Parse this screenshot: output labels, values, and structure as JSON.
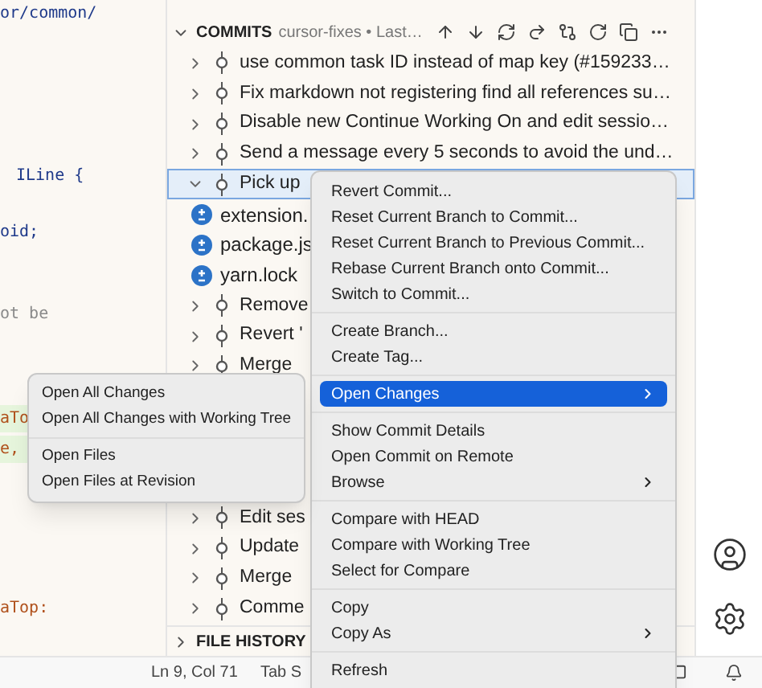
{
  "editor": {
    "lines": [
      {
        "text": "or/common/",
        "kind": "plain"
      },
      {
        "text": "ILine {",
        "kind": "plain"
      },
      {
        "text": "oid;",
        "kind": "plain"
      },
      {
        "text": "ot be",
        "kind": "comment"
      },
      {
        "text": "aTo",
        "kind": "added"
      },
      {
        "text": "e,",
        "kind": "added"
      },
      {
        "text": "aTop:",
        "kind": "string"
      }
    ]
  },
  "commits": {
    "title": "COMMITS",
    "branch": "cursor-fixes • Last…",
    "rows": [
      {
        "kind": "commit",
        "label": "use common task ID instead of map key (#159233…",
        "expanded": false,
        "selected": false
      },
      {
        "kind": "commit",
        "label": "Fix markdown not registering find all references su…",
        "expanded": false,
        "selected": false
      },
      {
        "kind": "commit",
        "label": "Disable new Continue Working On and edit sessio…",
        "expanded": false,
        "selected": false
      },
      {
        "kind": "commit",
        "label": "Send a message every 5 seconds to avoid the und…",
        "expanded": false,
        "selected": false
      },
      {
        "kind": "commit",
        "label": "Pick up",
        "expanded": true,
        "selected": true
      },
      {
        "kind": "file",
        "label": "extension."
      },
      {
        "kind": "file",
        "label": "package.js"
      },
      {
        "kind": "file",
        "label": "yarn.lock"
      },
      {
        "kind": "commit",
        "label": "Remove",
        "expanded": false,
        "selected": false
      },
      {
        "kind": "commit",
        "label": "Revert '",
        "expanded": false,
        "selected": false
      },
      {
        "kind": "commit",
        "label": "Merge",
        "expanded": false,
        "selected": false
      },
      {
        "kind": "gap"
      },
      {
        "kind": "gap"
      },
      {
        "kind": "gap"
      },
      {
        "kind": "gap"
      },
      {
        "kind": "commit",
        "label": "Edit ses",
        "expanded": false,
        "selected": false
      },
      {
        "kind": "commit",
        "label": "Update",
        "expanded": false,
        "selected": false
      },
      {
        "kind": "commit",
        "label": "Merge",
        "expanded": false,
        "selected": false
      },
      {
        "kind": "commit",
        "label": "Comme",
        "expanded": false,
        "selected": false
      }
    ]
  },
  "file_history": {
    "title": "FILE HISTORY",
    "expanded": false
  },
  "status_bar": {
    "position": "Ln 9, Col 71",
    "indent": "Tab S"
  },
  "context_menu": {
    "groups": [
      [
        {
          "label": "Revert Commit..."
        },
        {
          "label": "Reset Current Branch to Commit..."
        },
        {
          "label": "Reset Current Branch to Previous Commit..."
        },
        {
          "label": "Rebase Current Branch onto Commit..."
        },
        {
          "label": "Switch to Commit..."
        }
      ],
      [
        {
          "label": "Create Branch..."
        },
        {
          "label": "Create Tag..."
        }
      ],
      [
        {
          "label": "Open Changes",
          "submenu": true,
          "selected": true
        }
      ],
      [
        {
          "label": "Show Commit Details"
        },
        {
          "label": "Open Commit on Remote"
        },
        {
          "label": "Browse",
          "submenu": true
        }
      ],
      [
        {
          "label": "Compare with HEAD"
        },
        {
          "label": "Compare with Working Tree"
        },
        {
          "label": "Select for Compare"
        }
      ],
      [
        {
          "label": "Copy"
        },
        {
          "label": "Copy As",
          "submenu": true
        }
      ],
      [
        {
          "label": "Refresh"
        }
      ]
    ]
  },
  "submenu": {
    "groups": [
      [
        {
          "label": "Open All Changes"
        },
        {
          "label": "Open All Changes with Working Tree"
        }
      ],
      [
        {
          "label": "Open Files"
        },
        {
          "label": "Open Files at Revision"
        }
      ]
    ]
  }
}
